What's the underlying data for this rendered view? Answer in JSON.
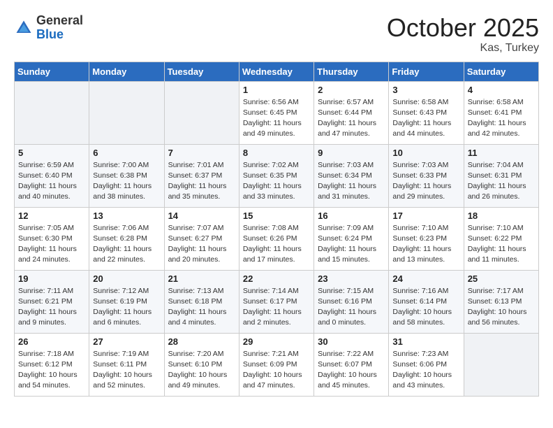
{
  "logo": {
    "general": "General",
    "blue": "Blue"
  },
  "header": {
    "month": "October 2025",
    "location": "Kas, Turkey"
  },
  "weekdays": [
    "Sunday",
    "Monday",
    "Tuesday",
    "Wednesday",
    "Thursday",
    "Friday",
    "Saturday"
  ],
  "weeks": [
    [
      {
        "day": "",
        "info": ""
      },
      {
        "day": "",
        "info": ""
      },
      {
        "day": "",
        "info": ""
      },
      {
        "day": "1",
        "info": "Sunrise: 6:56 AM\nSunset: 6:45 PM\nDaylight: 11 hours\nand 49 minutes."
      },
      {
        "day": "2",
        "info": "Sunrise: 6:57 AM\nSunset: 6:44 PM\nDaylight: 11 hours\nand 47 minutes."
      },
      {
        "day": "3",
        "info": "Sunrise: 6:58 AM\nSunset: 6:43 PM\nDaylight: 11 hours\nand 44 minutes."
      },
      {
        "day": "4",
        "info": "Sunrise: 6:58 AM\nSunset: 6:41 PM\nDaylight: 11 hours\nand 42 minutes."
      }
    ],
    [
      {
        "day": "5",
        "info": "Sunrise: 6:59 AM\nSunset: 6:40 PM\nDaylight: 11 hours\nand 40 minutes."
      },
      {
        "day": "6",
        "info": "Sunrise: 7:00 AM\nSunset: 6:38 PM\nDaylight: 11 hours\nand 38 minutes."
      },
      {
        "day": "7",
        "info": "Sunrise: 7:01 AM\nSunset: 6:37 PM\nDaylight: 11 hours\nand 35 minutes."
      },
      {
        "day": "8",
        "info": "Sunrise: 7:02 AM\nSunset: 6:35 PM\nDaylight: 11 hours\nand 33 minutes."
      },
      {
        "day": "9",
        "info": "Sunrise: 7:03 AM\nSunset: 6:34 PM\nDaylight: 11 hours\nand 31 minutes."
      },
      {
        "day": "10",
        "info": "Sunrise: 7:03 AM\nSunset: 6:33 PM\nDaylight: 11 hours\nand 29 minutes."
      },
      {
        "day": "11",
        "info": "Sunrise: 7:04 AM\nSunset: 6:31 PM\nDaylight: 11 hours\nand 26 minutes."
      }
    ],
    [
      {
        "day": "12",
        "info": "Sunrise: 7:05 AM\nSunset: 6:30 PM\nDaylight: 11 hours\nand 24 minutes."
      },
      {
        "day": "13",
        "info": "Sunrise: 7:06 AM\nSunset: 6:28 PM\nDaylight: 11 hours\nand 22 minutes."
      },
      {
        "day": "14",
        "info": "Sunrise: 7:07 AM\nSunset: 6:27 PM\nDaylight: 11 hours\nand 20 minutes."
      },
      {
        "day": "15",
        "info": "Sunrise: 7:08 AM\nSunset: 6:26 PM\nDaylight: 11 hours\nand 17 minutes."
      },
      {
        "day": "16",
        "info": "Sunrise: 7:09 AM\nSunset: 6:24 PM\nDaylight: 11 hours\nand 15 minutes."
      },
      {
        "day": "17",
        "info": "Sunrise: 7:10 AM\nSunset: 6:23 PM\nDaylight: 11 hours\nand 13 minutes."
      },
      {
        "day": "18",
        "info": "Sunrise: 7:10 AM\nSunset: 6:22 PM\nDaylight: 11 hours\nand 11 minutes."
      }
    ],
    [
      {
        "day": "19",
        "info": "Sunrise: 7:11 AM\nSunset: 6:21 PM\nDaylight: 11 hours\nand 9 minutes."
      },
      {
        "day": "20",
        "info": "Sunrise: 7:12 AM\nSunset: 6:19 PM\nDaylight: 11 hours\nand 6 minutes."
      },
      {
        "day": "21",
        "info": "Sunrise: 7:13 AM\nSunset: 6:18 PM\nDaylight: 11 hours\nand 4 minutes."
      },
      {
        "day": "22",
        "info": "Sunrise: 7:14 AM\nSunset: 6:17 PM\nDaylight: 11 hours\nand 2 minutes."
      },
      {
        "day": "23",
        "info": "Sunrise: 7:15 AM\nSunset: 6:16 PM\nDaylight: 11 hours\nand 0 minutes."
      },
      {
        "day": "24",
        "info": "Sunrise: 7:16 AM\nSunset: 6:14 PM\nDaylight: 10 hours\nand 58 minutes."
      },
      {
        "day": "25",
        "info": "Sunrise: 7:17 AM\nSunset: 6:13 PM\nDaylight: 10 hours\nand 56 minutes."
      }
    ],
    [
      {
        "day": "26",
        "info": "Sunrise: 7:18 AM\nSunset: 6:12 PM\nDaylight: 10 hours\nand 54 minutes."
      },
      {
        "day": "27",
        "info": "Sunrise: 7:19 AM\nSunset: 6:11 PM\nDaylight: 10 hours\nand 52 minutes."
      },
      {
        "day": "28",
        "info": "Sunrise: 7:20 AM\nSunset: 6:10 PM\nDaylight: 10 hours\nand 49 minutes."
      },
      {
        "day": "29",
        "info": "Sunrise: 7:21 AM\nSunset: 6:09 PM\nDaylight: 10 hours\nand 47 minutes."
      },
      {
        "day": "30",
        "info": "Sunrise: 7:22 AM\nSunset: 6:07 PM\nDaylight: 10 hours\nand 45 minutes."
      },
      {
        "day": "31",
        "info": "Sunrise: 7:23 AM\nSunset: 6:06 PM\nDaylight: 10 hours\nand 43 minutes."
      },
      {
        "day": "",
        "info": ""
      }
    ]
  ]
}
